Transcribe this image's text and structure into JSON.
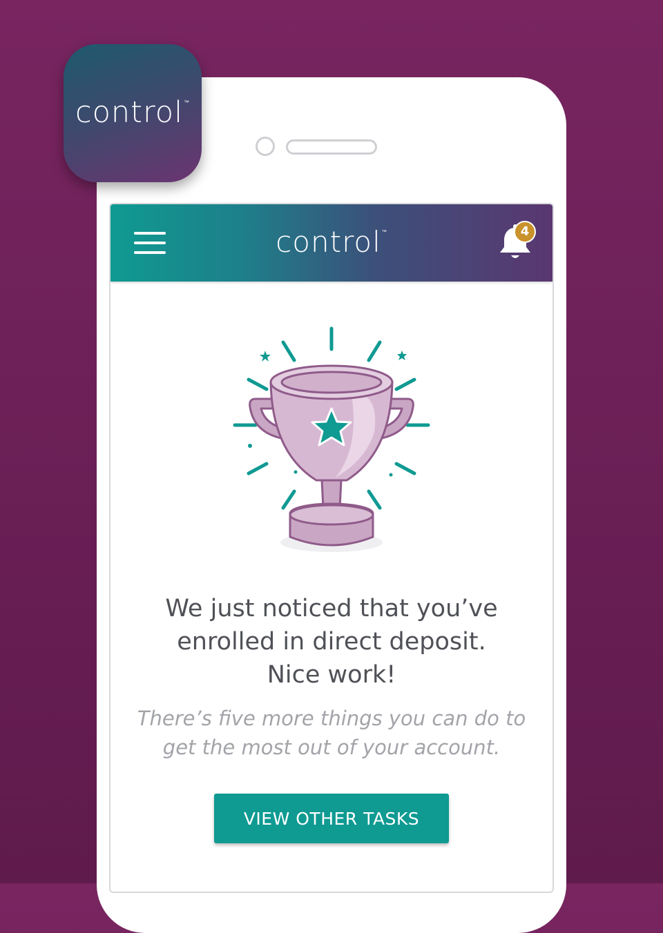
{
  "app_icon": {
    "brand": "control",
    "trademark": "™"
  },
  "header": {
    "brand": "control",
    "trademark": "™",
    "notification_count": "4",
    "icons": {
      "menu": "hamburger-icon",
      "notifications": "bell-icon"
    }
  },
  "main": {
    "illustration": "trophy-illustration",
    "headline_lines": [
      "We just noticed that you’ve",
      "enrolled in direct deposit.",
      "Nice work!"
    ],
    "subtext_lines": [
      "There’s five more things you can do to",
      "get the most out of your account."
    ],
    "cta_label": "VIEW OTHER TASKS"
  },
  "colors": {
    "background": "#782560",
    "teal": "#0f9a92",
    "purple": "#5a3770",
    "badge": "#c9922a",
    "trophy": "#c9a7c4"
  }
}
